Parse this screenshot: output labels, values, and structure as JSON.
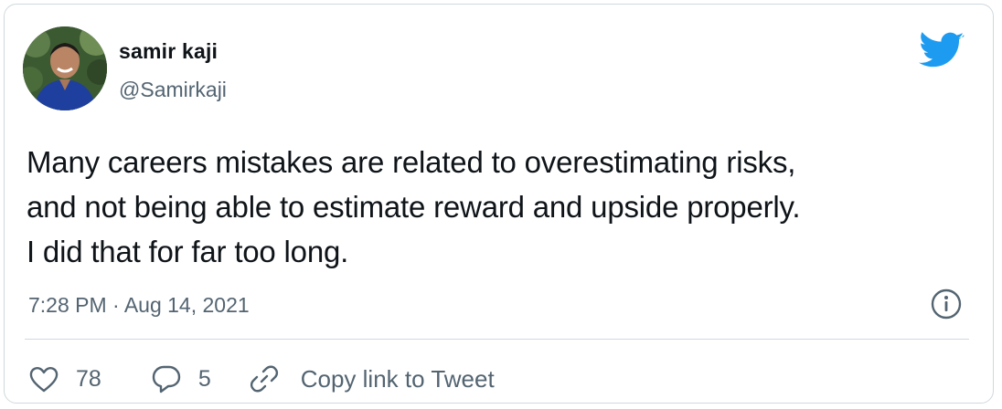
{
  "tweet": {
    "author_name": "samir kaji",
    "author_handle": "@Samirkaji",
    "text_lines": [
      "Many careers mistakes are related to overestimating risks,",
      "and not being able to estimate reward and upside properly.",
      "I did that for far too long."
    ],
    "timestamp": "7:28 PM · Aug 14, 2021"
  },
  "actions": {
    "like_count": "78",
    "reply_count": "5",
    "copy_link_label": "Copy link to Tweet"
  },
  "icons": {
    "brand": "twitter-bird-icon",
    "info": "info-icon",
    "like": "heart-icon",
    "reply": "speech-bubble-icon",
    "copy": "link-icon"
  },
  "colors": {
    "brand": "#1d9bf0",
    "text": "#0f1419",
    "secondary": "#536471",
    "border": "#cfd9de"
  }
}
